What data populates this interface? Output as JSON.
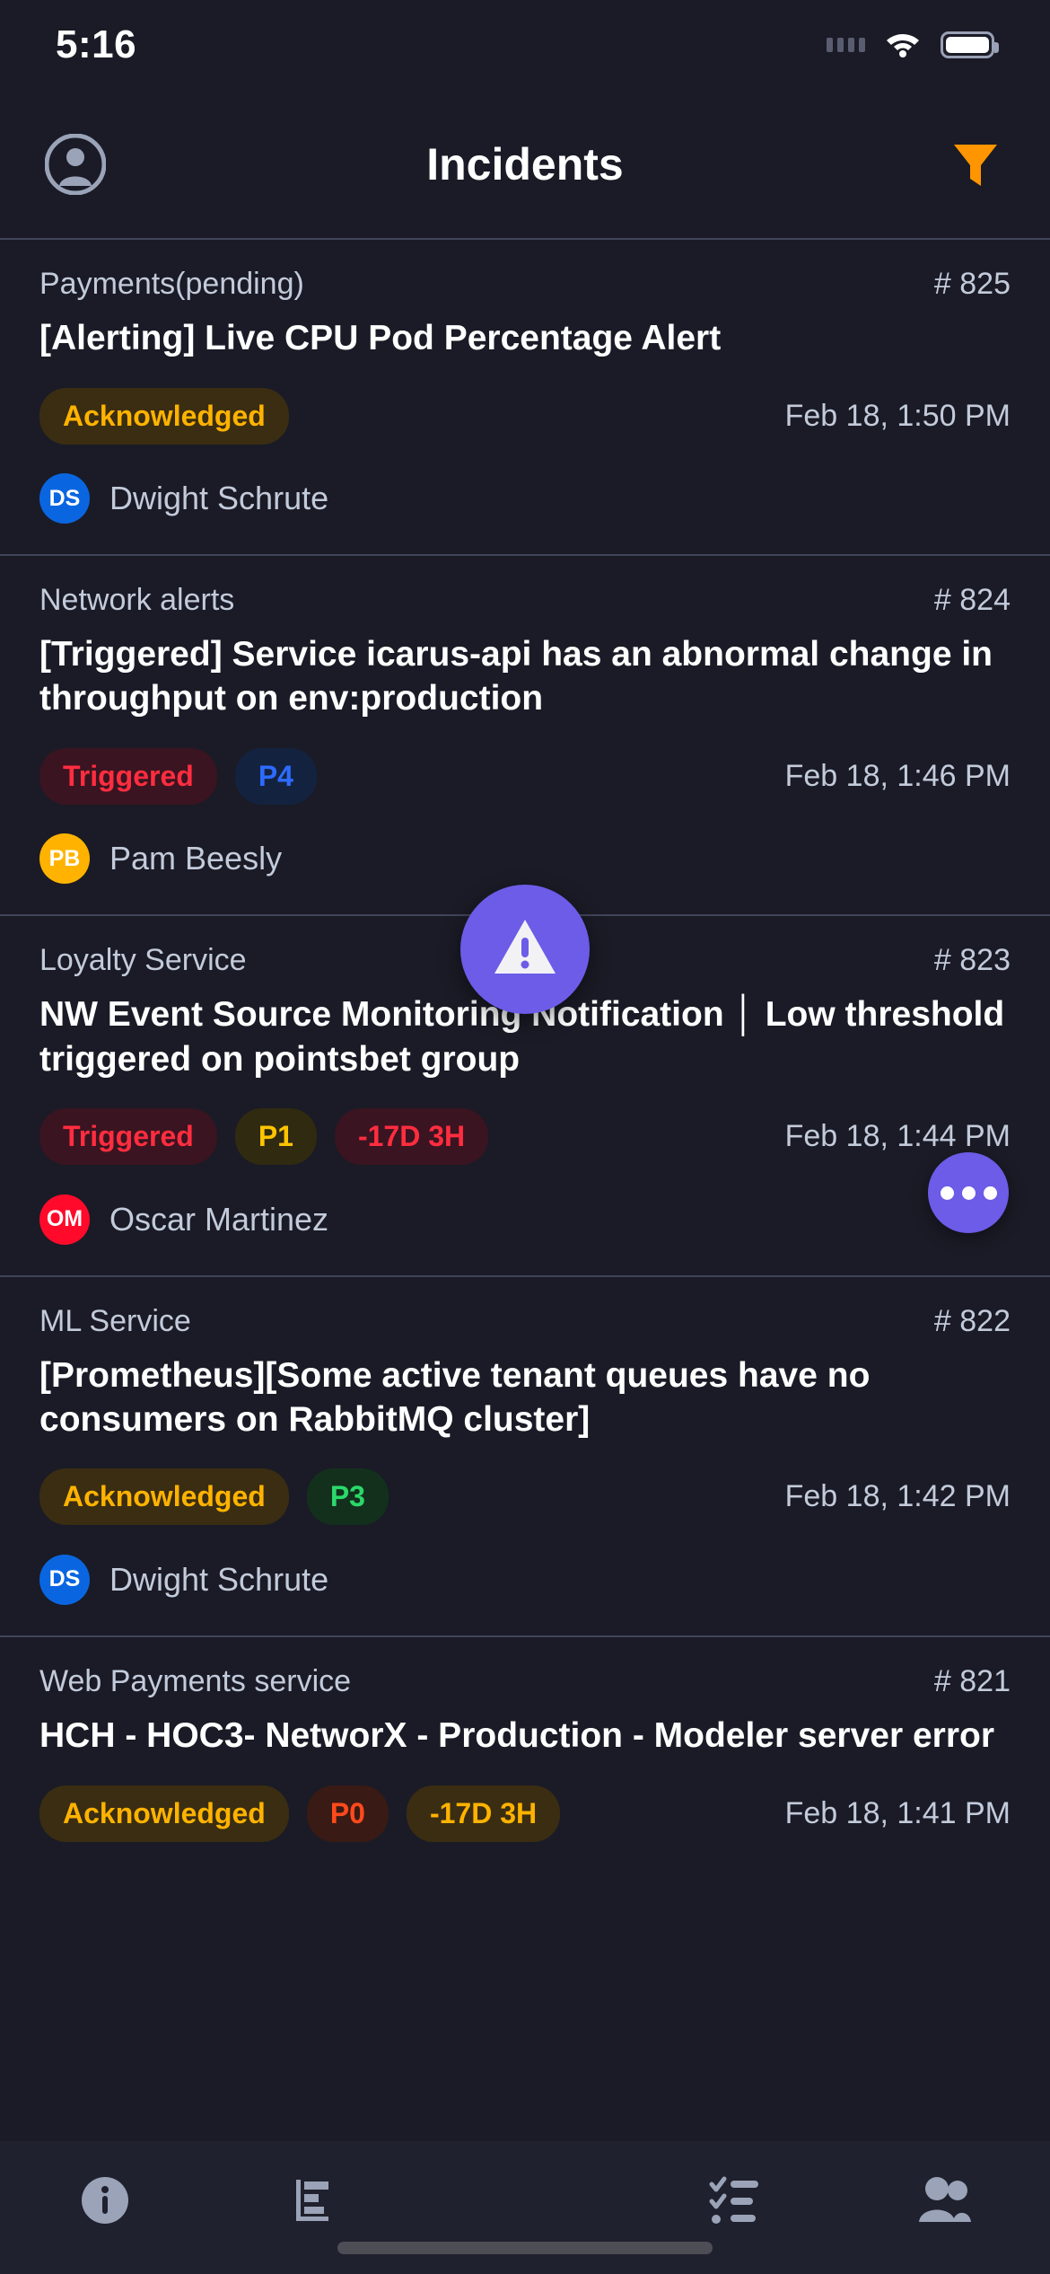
{
  "status_bar": {
    "time": "5:16",
    "signal_icon": "signal-dots-icon",
    "wifi_icon": "wifi-icon",
    "battery_icon": "battery-icon"
  },
  "header": {
    "title": "Incidents",
    "avatar_icon": "account-circle-icon",
    "filter_icon": "filter-funnel-icon",
    "filter_color": "#FF9500"
  },
  "colors": {
    "background": "#1a1b26",
    "separator": "#41455a",
    "accent_purple": "#6c5ce7",
    "status_acknowledged_text": "#FFB300",
    "status_acknowledged_bg": "#3a2d12",
    "status_triggered_text": "#FF2D3F",
    "status_triggered_bg": "#3a1420"
  },
  "incidents": [
    {
      "service": "Payments(pending)",
      "id": "# 825",
      "title": "[Alerting] Live CPU Pod Percentage Alert",
      "time": "Feb 18, 1:50 PM",
      "badges": [
        {
          "label": "Acknowledged",
          "text_color": "#FFB300",
          "bg_color": "#3a2d12"
        }
      ],
      "assignee": {
        "initials": "DS",
        "name": "Dwight Schrute",
        "color": "#0A66E0"
      }
    },
    {
      "service": "Network alerts",
      "id": "# 824",
      "title": "[Triggered] Service icarus-api has an abnormal change in throughput on env:production",
      "time": "Feb 18, 1:46 PM",
      "badges": [
        {
          "label": "Triggered",
          "text_color": "#FF2D3F",
          "bg_color": "#3a1420"
        },
        {
          "label": "P4",
          "text_color": "#2D6BFF",
          "bg_color": "#13233f"
        }
      ],
      "assignee": {
        "initials": "PB",
        "name": "Pam Beesly",
        "color": "#FFB300"
      }
    },
    {
      "service": "Loyalty Service",
      "id": "# 823",
      "title": "NW Event Source Monitoring Notification │ Low threshold triggered on pointsbet group",
      "time": "Feb 18, 1:44 PM",
      "badges": [
        {
          "label": "Triggered",
          "text_color": "#FF2D3F",
          "bg_color": "#3a1420"
        },
        {
          "label": "P1",
          "text_color": "#FFC400",
          "bg_color": "#302a10"
        },
        {
          "label": "-17D 3H",
          "text_color": "#FF2D3F",
          "bg_color": "#3a1420"
        }
      ],
      "assignee": {
        "initials": "OM",
        "name": "Oscar Martinez",
        "color": "#FF0A2B"
      }
    },
    {
      "service": "ML Service",
      "id": "# 822",
      "title": "[Prometheus][Some active tenant queues have no consumers on RabbitMQ cluster]",
      "time": "Feb 18, 1:42 PM",
      "badges": [
        {
          "label": "Acknowledged",
          "text_color": "#FFB300",
          "bg_color": "#3a2d12"
        },
        {
          "label": "P3",
          "text_color": "#2BD96A",
          "bg_color": "#13301d"
        }
      ],
      "assignee": {
        "initials": "DS",
        "name": "Dwight Schrute",
        "color": "#0A66E0"
      }
    },
    {
      "service": "Web Payments service",
      "id": "# 821",
      "title": "HCH - HOC3- NetworX - Production - Modeler server error",
      "time": "Feb 18, 1:41 PM",
      "badges": [
        {
          "label": "Acknowledged",
          "text_color": "#FFB300",
          "bg_color": "#3a2d12"
        },
        {
          "label": "P0",
          "text_color": "#FF4A1C",
          "bg_color": "#3a1a14"
        },
        {
          "label": "-17D 3H",
          "text_color": "#FFB300",
          "bg_color": "#3a2d12"
        }
      ],
      "assignee": null
    }
  ],
  "fab_more": {
    "icon": "more-horizontal-icon"
  },
  "fab_main": {
    "icon": "warning-triangle-icon"
  },
  "tabbar": {
    "items": [
      {
        "icon": "info-icon",
        "name": "tab-info"
      },
      {
        "icon": "bar-chart-icon",
        "name": "tab-reports"
      },
      {
        "icon": "checklist-icon",
        "name": "tab-tasks"
      },
      {
        "icon": "people-icon",
        "name": "tab-teams"
      }
    ]
  }
}
